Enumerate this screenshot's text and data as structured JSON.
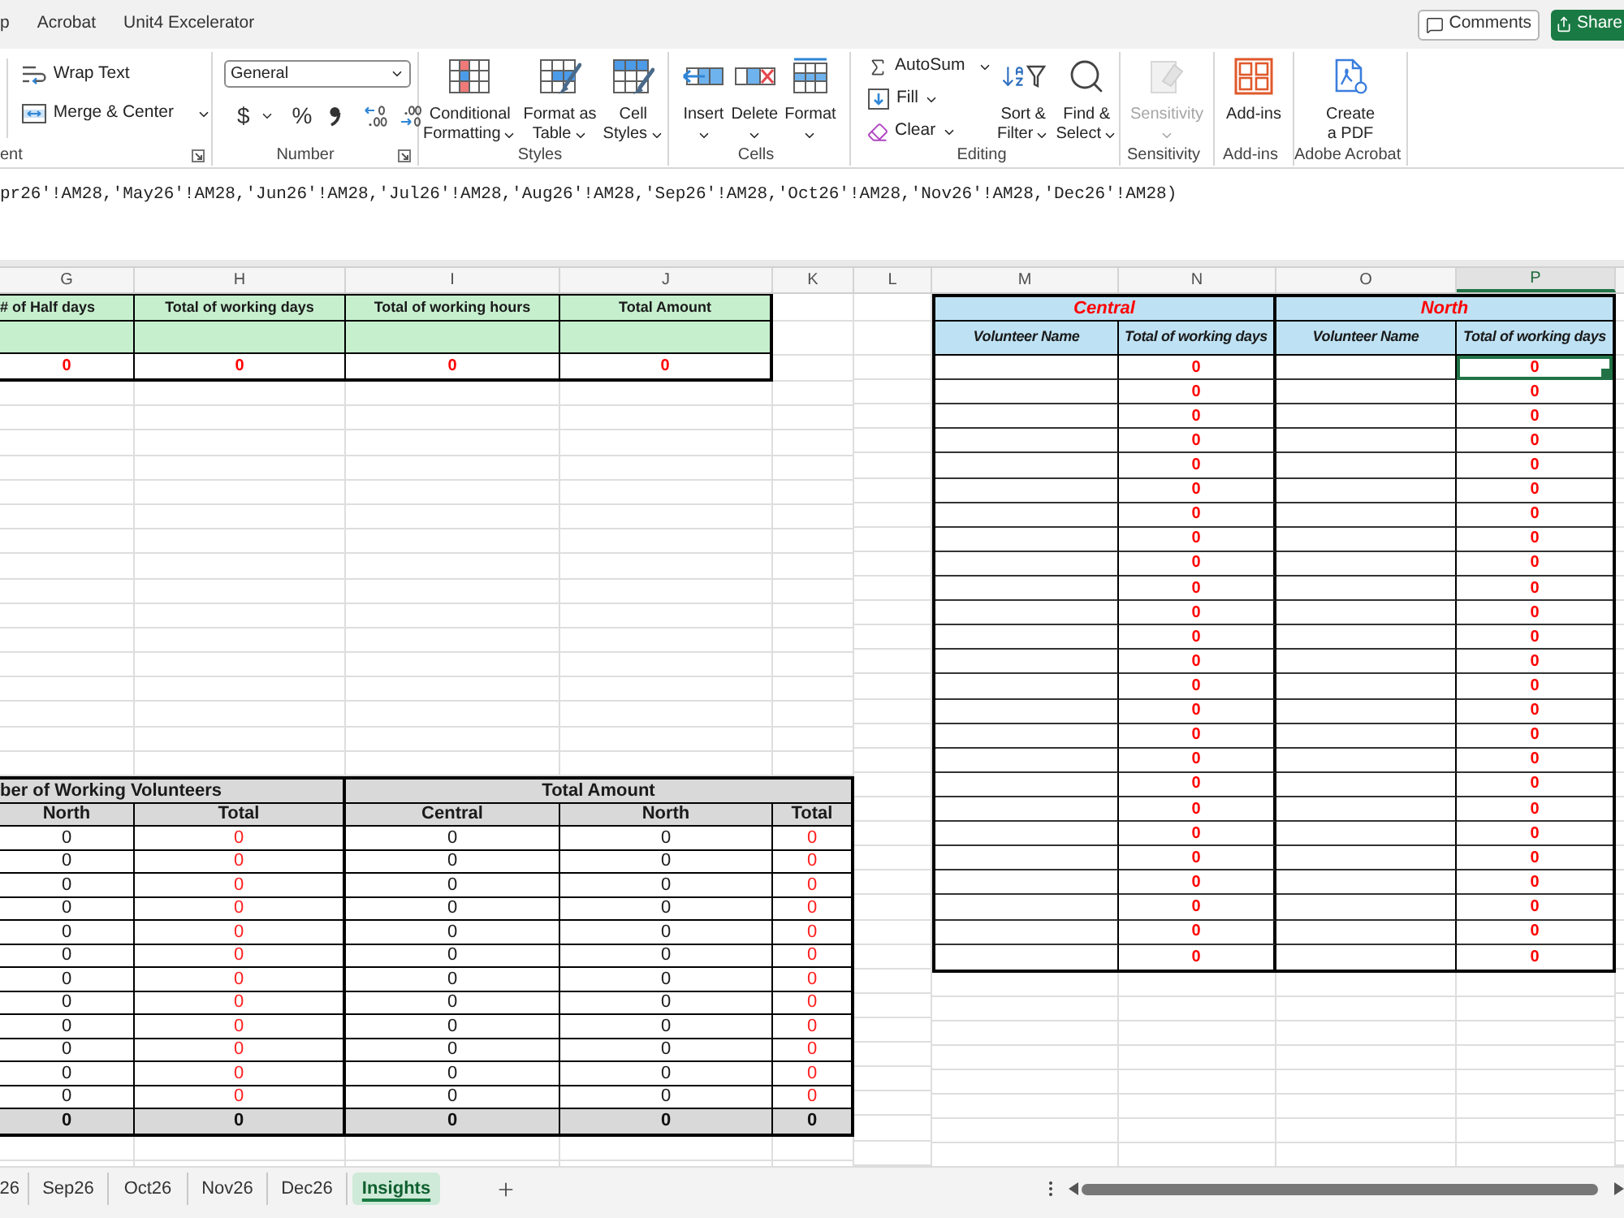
{
  "title_bar": {
    "tabs": [
      {
        "label": "p"
      },
      {
        "label": "Acrobat"
      },
      {
        "label": "Unit4 Excelerator"
      }
    ],
    "comments_button": "Comments",
    "share_button": "Share"
  },
  "ribbon_groups": [
    {
      "kind": "alignment",
      "label": "ent",
      "launcher": true,
      "commands": [
        {
          "label": "Wrap Text",
          "dropdown": false
        },
        {
          "label": "Merge & Center",
          "dropdown": true
        }
      ]
    },
    {
      "kind": "number",
      "label": "Number",
      "launcher": true,
      "format": "General",
      "symbols": [
        {
          "label": "$",
          "dropdown": true
        },
        {
          "label": "%",
          "dropdown": false
        }
      ]
    },
    {
      "kind": "styles",
      "label": "Styles",
      "launcher": false,
      "commands": [
        {
          "lines": [
            "Conditional",
            "Formatting"
          ],
          "dropdown": true,
          "disabled": false
        },
        {
          "lines": [
            "Format as",
            "Table"
          ],
          "dropdown": true,
          "disabled": false
        },
        {
          "lines": [
            "Cell",
            "Styles"
          ],
          "dropdown": true,
          "disabled": false
        }
      ]
    },
    {
      "kind": "cells",
      "label": "Cells",
      "launcher": false,
      "commands": [
        {
          "lines": [
            "Insert"
          ],
          "dropdown": true,
          "disabled": false
        },
        {
          "lines": [
            "Delete"
          ],
          "dropdown": true,
          "disabled": false
        },
        {
          "lines": [
            "Format"
          ],
          "dropdown": true,
          "disabled": false
        }
      ]
    },
    {
      "kind": "editing",
      "label": "Editing",
      "launcher": false,
      "small_commands": [
        {
          "label": "AutoSum",
          "dropdown": true
        },
        {
          "label": "Fill",
          "dropdown": true
        },
        {
          "label": "Clear",
          "dropdown": true
        }
      ],
      "commands": [
        {
          "lines": [
            "Sort &",
            "Filter"
          ],
          "dropdown": true,
          "disabled": false
        },
        {
          "lines": [
            "Find &",
            "Select"
          ],
          "dropdown": true,
          "disabled": false
        }
      ]
    },
    {
      "kind": "sensitivity",
      "label": "Sensitivity",
      "launcher": false,
      "commands": [
        {
          "lines": [
            "Sensitivity"
          ],
          "dropdown": true,
          "disabled": true
        }
      ]
    },
    {
      "kind": "addins",
      "label": "Add-ins",
      "launcher": false,
      "commands": [
        {
          "lines": [
            "Add-ins"
          ],
          "dropdown": false,
          "disabled": false
        }
      ]
    },
    {
      "kind": "acrobat",
      "label": "Adobe Acrobat",
      "launcher": false,
      "commands": [
        {
          "lines": [
            "Create",
            "a PDF"
          ],
          "dropdown": false,
          "disabled": false
        }
      ]
    }
  ],
  "formula_bar": {
    "text": "pr26'!AM28,'May26'!AM28,'Jun26'!AM28,'Jul26'!AM28,'Aug26'!AM28,'Sep26'!AM28,'Oct26'!AM28,'Nov26'!AM28,'Dec26'!AM28)"
  },
  "columns": [
    {
      "letter": "G",
      "selected": false
    },
    {
      "letter": "H",
      "selected": false
    },
    {
      "letter": "I",
      "selected": false
    },
    {
      "letter": "J",
      "selected": false
    },
    {
      "letter": "K",
      "selected": false
    },
    {
      "letter": "L",
      "selected": false
    },
    {
      "letter": "M",
      "selected": false
    },
    {
      "letter": "N",
      "selected": false
    },
    {
      "letter": "O",
      "selected": false
    },
    {
      "letter": "P",
      "selected": true
    }
  ],
  "summary_table": {
    "headers": [
      "# of Half days",
      "Total of working days",
      "Total of working hours",
      "Total Amount"
    ],
    "values": [
      "0",
      "0",
      "0",
      "0"
    ]
  },
  "volunteers_table": {
    "groups": [
      {
        "title": "ber of Working Volunteers",
        "columns": [
          {
            "label": "North",
            "kind": "region"
          },
          {
            "label": "Total",
            "kind": "total"
          }
        ]
      },
      {
        "title": "Total Amount",
        "columns": [
          {
            "label": "Central",
            "kind": "region"
          },
          {
            "label": "North",
            "kind": "region"
          },
          {
            "label": "Total",
            "kind": "total"
          }
        ]
      }
    ],
    "rows": [
      {
        "values": [
          "0",
          "0",
          "0",
          "0",
          "0"
        ]
      },
      {
        "values": [
          "0",
          "0",
          "0",
          "0",
          "0"
        ]
      },
      {
        "values": [
          "0",
          "0",
          "0",
          "0",
          "0"
        ]
      },
      {
        "values": [
          "0",
          "0",
          "0",
          "0",
          "0"
        ]
      },
      {
        "values": [
          "0",
          "0",
          "0",
          "0",
          "0"
        ]
      },
      {
        "values": [
          "0",
          "0",
          "0",
          "0",
          "0"
        ]
      },
      {
        "values": [
          "0",
          "0",
          "0",
          "0",
          "0"
        ]
      },
      {
        "values": [
          "0",
          "0",
          "0",
          "0",
          "0"
        ]
      },
      {
        "values": [
          "0",
          "0",
          "0",
          "0",
          "0"
        ]
      },
      {
        "values": [
          "0",
          "0",
          "0",
          "0",
          "0"
        ]
      },
      {
        "values": [
          "0",
          "0",
          "0",
          "0",
          "0"
        ]
      },
      {
        "values": [
          "0",
          "0",
          "0",
          "0",
          "0"
        ]
      }
    ],
    "totals": [
      "0",
      "0",
      "0",
      "0",
      "0"
    ]
  },
  "region_table": {
    "regions": [
      {
        "name": "Central",
        "columns": [
          "Volunteer Name",
          "Total of working days"
        ]
      },
      {
        "name": "North",
        "columns": [
          "Volunteer Name",
          "Total of working days"
        ]
      }
    ],
    "rows": [
      {
        "central_days": "0",
        "north_days": "0",
        "north_selected": true
      },
      {
        "central_days": "0",
        "north_days": "0",
        "north_selected": false
      },
      {
        "central_days": "0",
        "north_days": "0",
        "north_selected": false
      },
      {
        "central_days": "0",
        "north_days": "0",
        "north_selected": false
      },
      {
        "central_days": "0",
        "north_days": "0",
        "north_selected": false
      },
      {
        "central_days": "0",
        "north_days": "0",
        "north_selected": false
      },
      {
        "central_days": "0",
        "north_days": "0",
        "north_selected": false
      },
      {
        "central_days": "0",
        "north_days": "0",
        "north_selected": false
      },
      {
        "central_days": "0",
        "north_days": "0",
        "north_selected": false
      },
      {
        "central_days": "0",
        "north_days": "0",
        "north_selected": false
      },
      {
        "central_days": "0",
        "north_days": "0",
        "north_selected": false
      },
      {
        "central_days": "0",
        "north_days": "0",
        "north_selected": false
      },
      {
        "central_days": "0",
        "north_days": "0",
        "north_selected": false
      },
      {
        "central_days": "0",
        "north_days": "0",
        "north_selected": false
      },
      {
        "central_days": "0",
        "north_days": "0",
        "north_selected": false
      },
      {
        "central_days": "0",
        "north_days": "0",
        "north_selected": false
      },
      {
        "central_days": "0",
        "north_days": "0",
        "north_selected": false
      },
      {
        "central_days": "0",
        "north_days": "0",
        "north_selected": false
      },
      {
        "central_days": "0",
        "north_days": "0",
        "north_selected": false
      },
      {
        "central_days": "0",
        "north_days": "0",
        "north_selected": false
      },
      {
        "central_days": "0",
        "north_days": "0",
        "north_selected": false
      },
      {
        "central_days": "0",
        "north_days": "0",
        "north_selected": false
      },
      {
        "central_days": "0",
        "north_days": "0",
        "north_selected": false
      },
      {
        "central_days": "0",
        "north_days": "0",
        "north_selected": false
      },
      {
        "central_days": "0",
        "north_days": "0",
        "north_selected": false
      }
    ]
  },
  "sheet_tabs": [
    {
      "label": "26",
      "selected": false
    },
    {
      "label": "Sep26",
      "selected": false
    },
    {
      "label": "Oct26",
      "selected": false
    },
    {
      "label": "Nov26",
      "selected": false
    },
    {
      "label": "Dec26",
      "selected": false
    },
    {
      "label": "Insights",
      "selected": true
    }
  ]
}
